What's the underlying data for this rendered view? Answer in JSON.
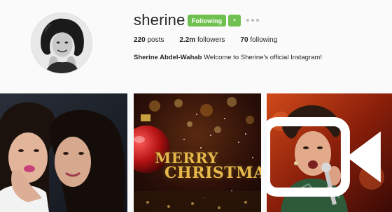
{
  "profile": {
    "username": "sherine",
    "follow_label": "Following",
    "dropdown_glyph": "▾",
    "stats": {
      "posts_value": "220",
      "posts_label": "posts",
      "followers_value": "2.2m",
      "followers_label": "followers",
      "following_value": "70",
      "following_label": "following"
    },
    "bio": {
      "name": "Sherine Abdel-Wahab",
      "text": "Welcome to Sherine's official Instagram!"
    },
    "accent_color": "#70c050"
  },
  "posts": {
    "tile_2": {
      "line_1": "MERRY",
      "line_2": "CHRISTMAS"
    },
    "tile_3": {
      "badge_icon": "video-camera-icon"
    }
  }
}
